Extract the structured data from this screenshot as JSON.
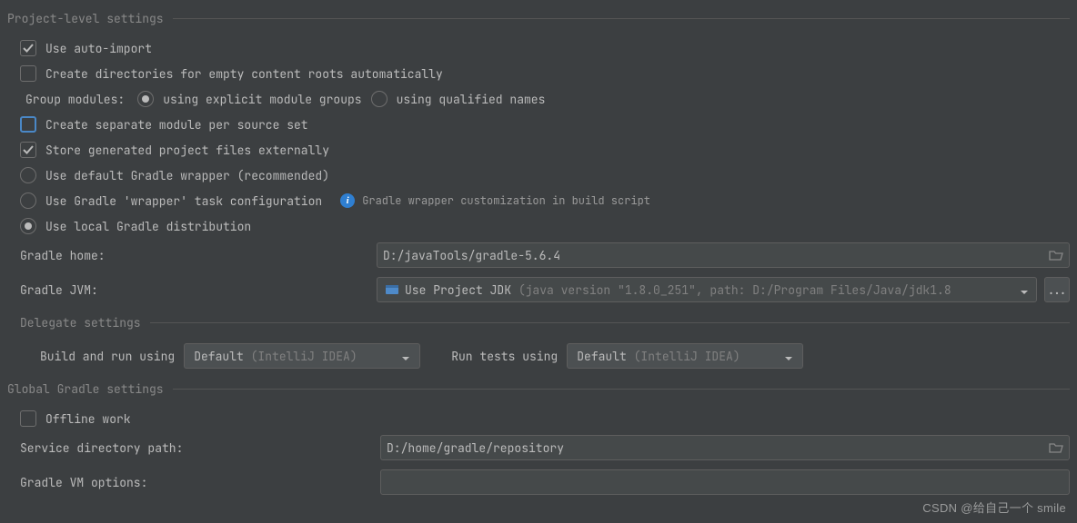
{
  "sections": {
    "project": "Project-level settings",
    "delegate": "Delegate settings",
    "global": "Global Gradle settings"
  },
  "options": {
    "auto_import": "Use auto-import",
    "create_dirs": "Create directories for empty content roots automatically",
    "group_modules_label": "Group modules:",
    "group_modules_explicit": "using explicit module groups",
    "group_modules_qualified": "using qualified names",
    "separate_module": "Create separate module per source set",
    "store_external": "Store generated project files externally",
    "gradle_default": "Use default Gradle wrapper (recommended)",
    "gradle_task": "Use Gradle 'wrapper' task configuration",
    "gradle_hint": "Gradle wrapper customization in build script",
    "gradle_local": "Use local Gradle distribution",
    "offline_work": "Offline work"
  },
  "fields": {
    "gradle_home_label": "Gradle home:",
    "gradle_home_value": "D:/javaTools/gradle-5.6.4",
    "gradle_jvm_label": "Gradle JVM:",
    "gradle_jvm_main": "Use Project JDK",
    "gradle_jvm_sub": " (java version \"1.8.0_251\", path: D:/Program Files/Java/jdk1.8",
    "service_dir_label": "Service directory path:",
    "service_dir_value": "D:/home/gradle/repository",
    "vm_options_label": "Gradle VM options:",
    "vm_options_value": ""
  },
  "delegate": {
    "build_label": "Build and run using",
    "tests_label": "Run tests using",
    "default_main": "Default",
    "default_sub": " (IntelliJ IDEA)"
  },
  "buttons": {
    "more": "..."
  },
  "watermark": "CSDN @给自己一个 smile"
}
